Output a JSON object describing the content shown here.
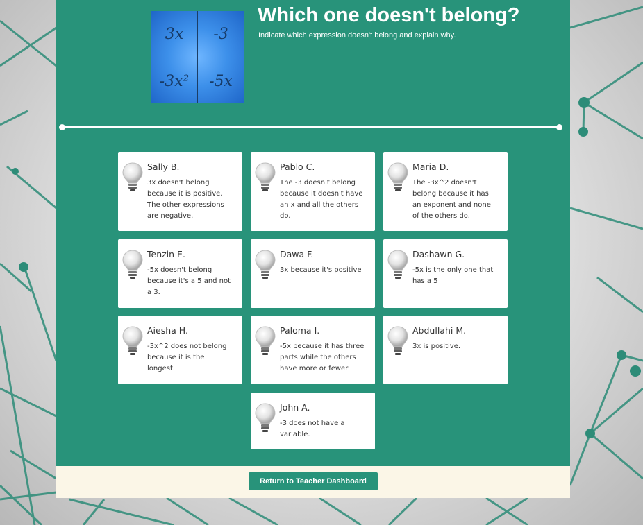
{
  "header": {
    "title": "Which one doesn't belong?",
    "subtitle": "Indicate which expression doesn't belong and explain why."
  },
  "thumbnail": {
    "cells": [
      "3x",
      "-3",
      "-3x²",
      "-5x"
    ]
  },
  "responses": [
    {
      "name": "Sally B.",
      "text": "3x doesn't belong because it is positive. The other expressions are negative."
    },
    {
      "name": "Pablo C.",
      "text": "The -3 doesn't belong because it doesn't have an x and all the others do."
    },
    {
      "name": "Maria D.",
      "text": "The -3x^2 doesn't belong because it has an exponent and none of the others do."
    },
    {
      "name": "Tenzin E.",
      "text": "-5x doesn't belong because it's a 5 and not a 3."
    },
    {
      "name": "Dawa F.",
      "text": "3x because it's positive"
    },
    {
      "name": "Dashawn G.",
      "text": "-5x is the only one that has a 5"
    },
    {
      "name": "Aiesha H.",
      "text": "-3x^2 does not belong because it is the longest."
    },
    {
      "name": "Paloma I.",
      "text": "-5x because it has three parts while the others have more or fewer"
    },
    {
      "name": "Abdullahi M.",
      "text": "3x is positive."
    },
    {
      "name": "John A.",
      "text": "-3 does not have a variable."
    }
  ],
  "footer": {
    "button_label": "Return to Teacher Dashboard"
  },
  "colors": {
    "panel": "#28937a",
    "footer": "#fbf6e7",
    "accent": "#28937a",
    "network": "#2d8c78"
  },
  "icons": {
    "response_icon": "lightbulb-icon"
  }
}
